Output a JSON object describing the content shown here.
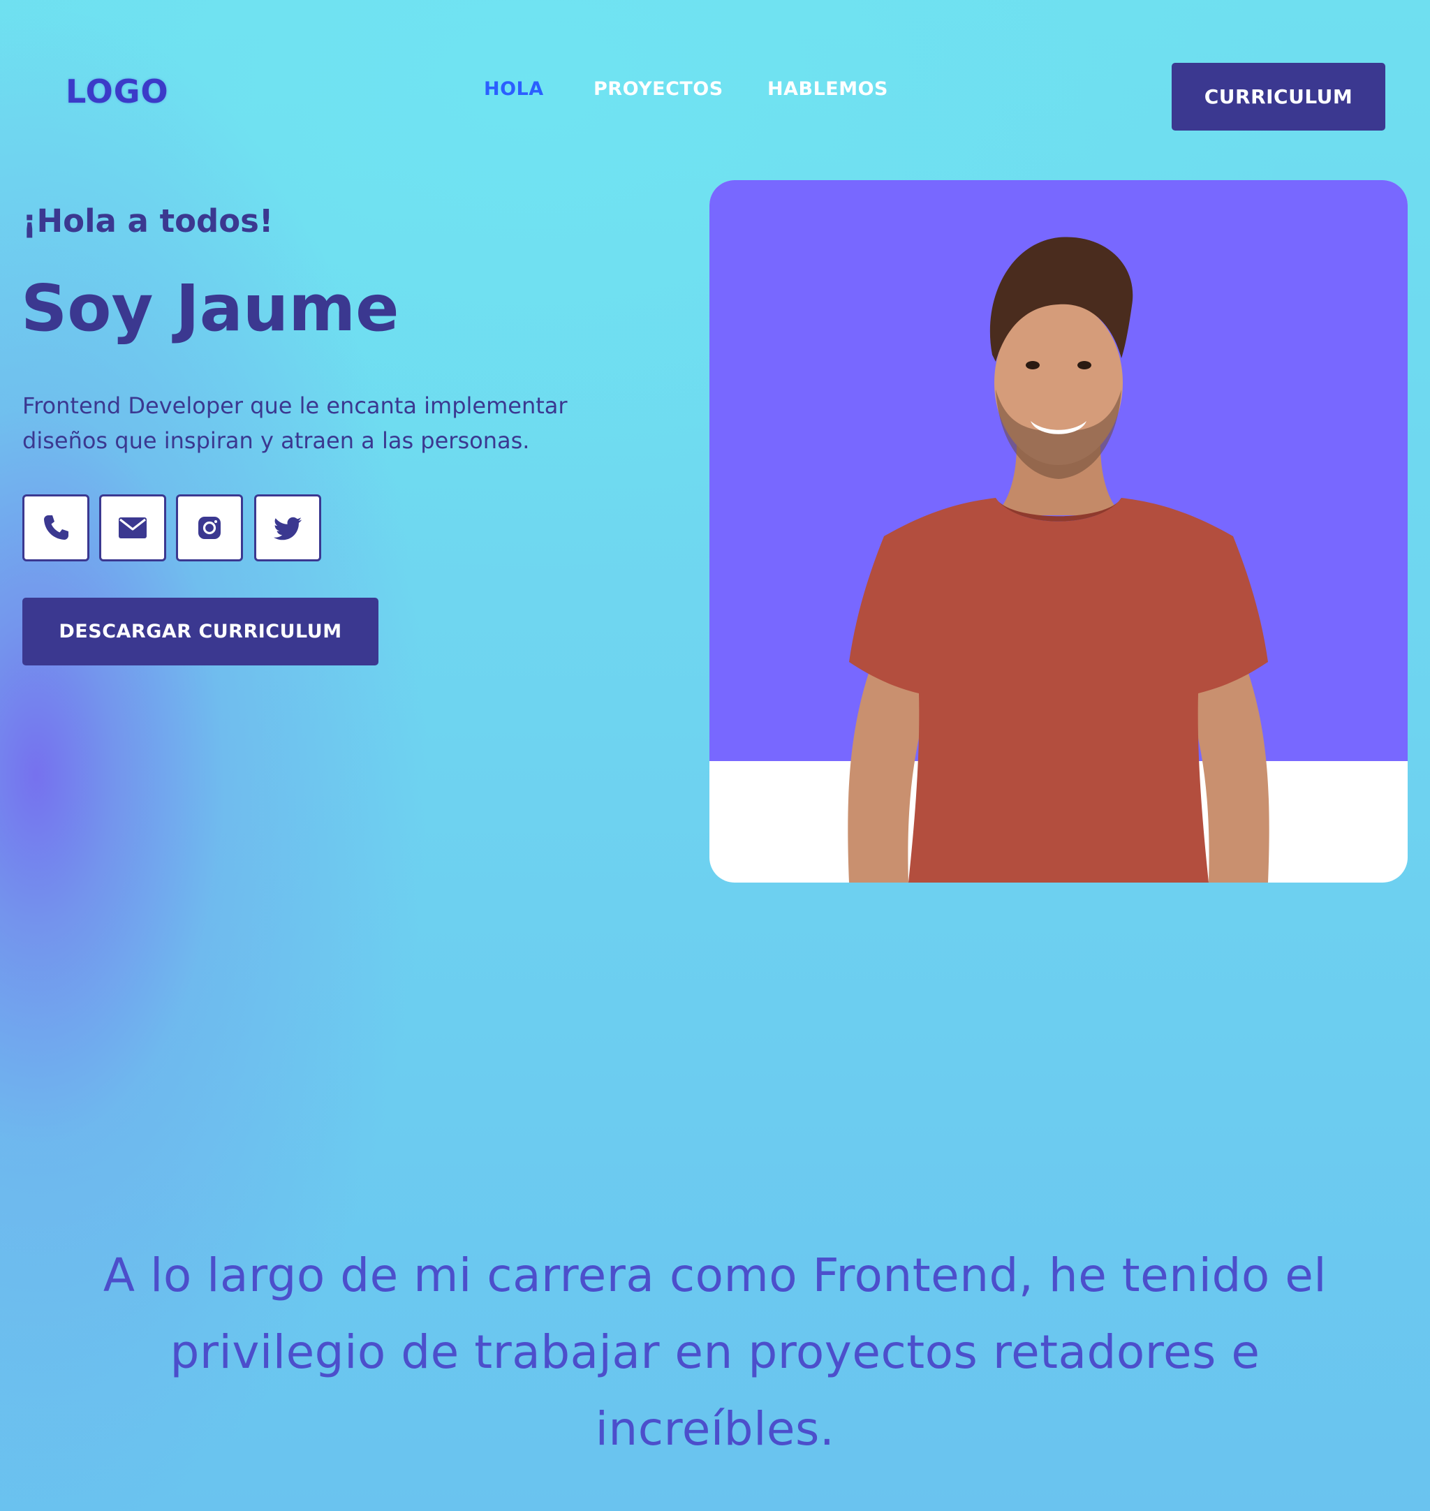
{
  "header": {
    "logo": "LOGO",
    "nav": [
      {
        "label": "HOLA",
        "active": true
      },
      {
        "label": "PROYECTOS",
        "active": false
      },
      {
        "label": "HABLEMOS",
        "active": false
      }
    ],
    "cv_button": "CURRICULUM"
  },
  "hero": {
    "greeting": "¡Hola a todos!",
    "title": "Soy Jaume",
    "description": "Frontend Developer que le encanta implementar diseños que inspiran y atraen a las personas.",
    "socials": [
      {
        "icon": "phone-icon"
      },
      {
        "icon": "email-icon"
      },
      {
        "icon": "instagram-icon"
      },
      {
        "icon": "twitter-icon"
      }
    ],
    "download_button": "DESCARGAR CURRICULUM"
  },
  "quote": "A lo largo de mi carrera como Frontend, he tenido el privilegio de trabajar en proyectos retadores e increíbles.",
  "colors": {
    "primary": "#3b3890",
    "nav_active": "#2b5fff",
    "photo_bg": "#7868ff"
  }
}
